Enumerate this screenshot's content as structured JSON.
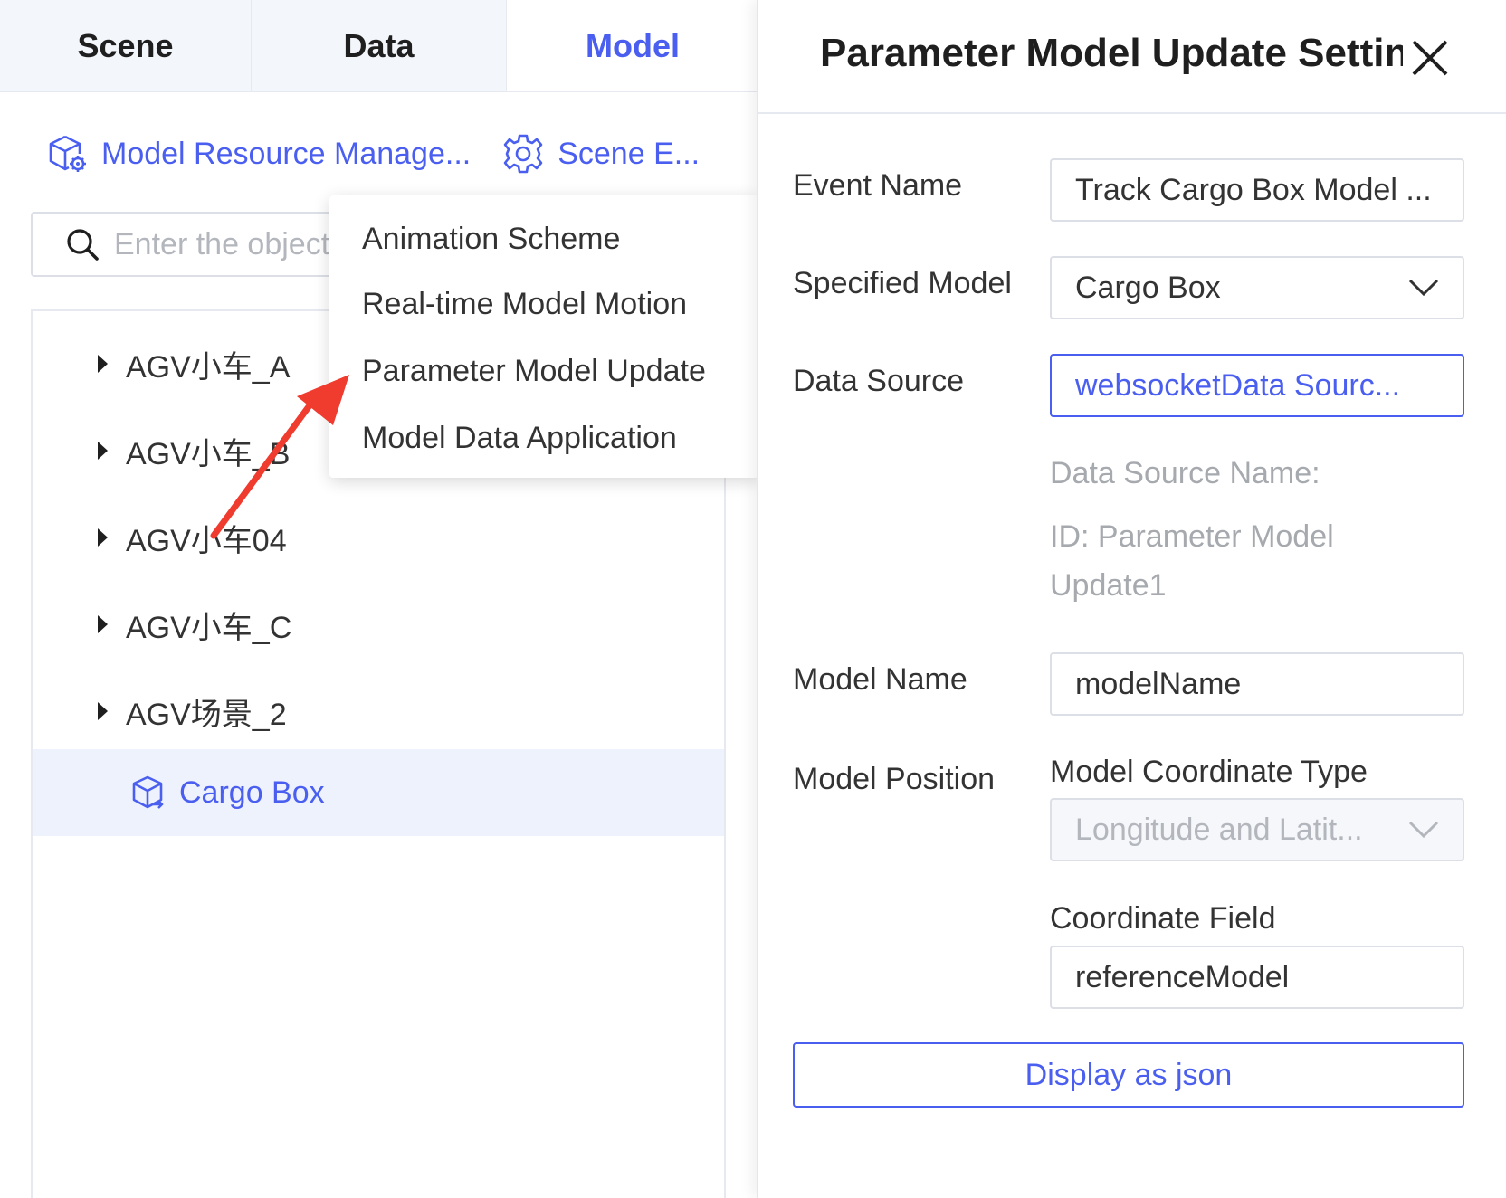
{
  "tabs": [
    {
      "label": "Scene"
    },
    {
      "label": "Data"
    },
    {
      "label": "Model"
    }
  ],
  "toolbar": {
    "model_resource_label": "Model Resource Manage...",
    "scene_label": "Scene E..."
  },
  "search": {
    "placeholder": "Enter the object"
  },
  "tree": {
    "items": [
      {
        "label": "AGV小车_A"
      },
      {
        "label": "AGV小车_B"
      },
      {
        "label": "AGV小车04"
      },
      {
        "label": "AGV小车_C"
      },
      {
        "label": "AGV场景_2"
      }
    ],
    "selected": {
      "label": "Cargo Box"
    }
  },
  "menu": {
    "items": [
      {
        "label": "Animation Scheme"
      },
      {
        "label": "Real-time Model Motion"
      },
      {
        "label": "Parameter Model Update"
      },
      {
        "label": "Model Data Application"
      }
    ]
  },
  "drawer": {
    "title": "Parameter Model Update Settings",
    "event_name": {
      "label": "Event Name",
      "value": "Track Cargo Box Model ..."
    },
    "specified_model": {
      "label": "Specified Model",
      "value": "Cargo Box"
    },
    "data_source": {
      "label": "Data Source",
      "value": "websocketData Sourc...",
      "name_hint": "Data Source Name:",
      "id_hint": "ID: Parameter Model Update1"
    },
    "model_name": {
      "label": "Model Name",
      "value": "modelName"
    },
    "model_position": {
      "label": "Model Position",
      "coord_type_label": "Model Coordinate Type",
      "coord_type_value": "Longitude and Latit...",
      "coord_field_label": "Coordinate Field",
      "coord_field_value": "referenceModel"
    },
    "json_button": "Display as json"
  },
  "colors": {
    "accent": "#4a5ff0",
    "annotation_arrow": "#f03b2f",
    "selected_row_bg": "#eef2fd"
  },
  "icons": {
    "model_resource": "cube-gear-icon",
    "scene": "gear-icon",
    "search": "search-icon",
    "tree_model": "cube-icon",
    "close": "close-icon",
    "dropdown": "chevron-down-icon"
  }
}
